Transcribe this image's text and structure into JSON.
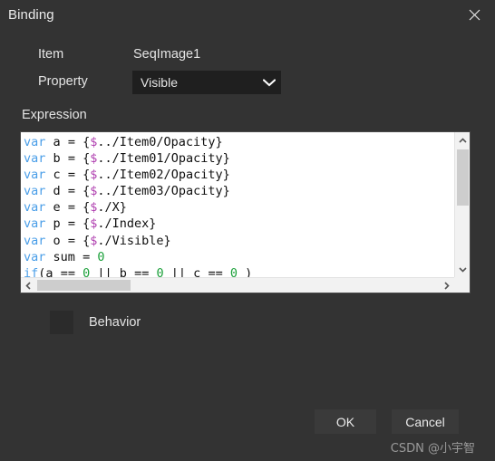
{
  "window": {
    "title": "Binding",
    "close_icon": "close-icon"
  },
  "form": {
    "item_label": "Item",
    "item_value": "SeqImage1",
    "property_label": "Property",
    "property_value": "Visible",
    "property_chevron_icon": "chevron-down-icon",
    "expression_label": "Expression"
  },
  "editor": {
    "lines": [
      "var a = {$../Item0/Opacity}",
      "var b = {$../Item01/Opacity}",
      "var c = {$../Item02/Opacity}",
      "var d = {$../Item03/Opacity}",
      "var e = {$./X}",
      "var p = {$./Index}",
      "var o = {$./Visible}",
      "var sum = 0",
      "if(a == 0 || b == 0 || c == 0 )"
    ],
    "vertical_scrollbar": {
      "up_icon": "chevron-up-icon",
      "down_icon": "chevron-down-icon"
    },
    "horizontal_scrollbar": {
      "left_icon": "chevron-left-icon",
      "right_icon": "chevron-right-icon"
    }
  },
  "behavior": {
    "label": "Behavior",
    "checked": false
  },
  "footer": {
    "ok_label": "OK",
    "cancel_label": "Cancel"
  },
  "watermark": {
    "text": "CSDN @小宇智"
  },
  "colors": {
    "dialog_background": "#333333",
    "editor_background": "#ffffff",
    "dropdown_background": "#1f1f1f",
    "button_background": "#3a3a3a",
    "keyword": "#4a9ee8",
    "dollar": "#b040b0",
    "number": "#1ba03a",
    "text": "#e8e8e8"
  }
}
